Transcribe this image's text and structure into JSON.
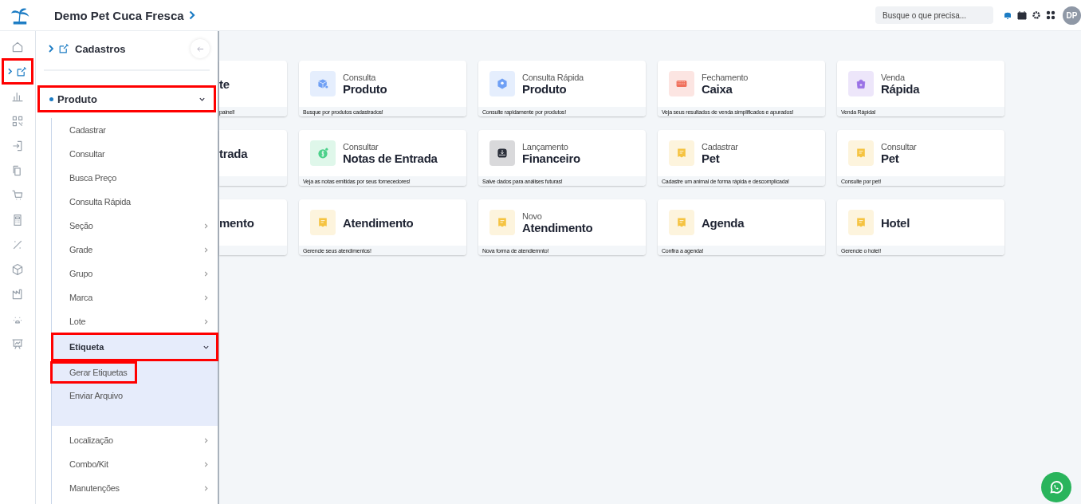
{
  "header": {
    "title": "Demo Pet Cuca Fresca",
    "search": {
      "placeholder": "Busque o que precisa..."
    },
    "avatar": "DP"
  },
  "rail": [
    {
      "selected": false,
      "annotated": false
    },
    {
      "selected": true,
      "annotated": true
    },
    {
      "selected": false,
      "annotated": false
    },
    {
      "selected": false,
      "annotated": false
    },
    {
      "selected": false,
      "annotated": false
    },
    {
      "selected": false,
      "annotated": false
    },
    {
      "selected": false,
      "annotated": false
    },
    {
      "selected": false,
      "annotated": false
    },
    {
      "selected": false,
      "annotated": false
    },
    {
      "selected": false,
      "annotated": false
    },
    {
      "selected": false,
      "annotated": false
    },
    {
      "selected": false,
      "annotated": false
    },
    {
      "selected": false,
      "annotated": false
    }
  ],
  "panel": {
    "title": "Cadastros",
    "section": {
      "label": "Produto",
      "expanded": true,
      "annotated": true,
      "items": [
        {
          "label": "Cadastrar",
          "expandable": false,
          "expanded": false,
          "annotated": false
        },
        {
          "label": "Consultar",
          "expandable": false,
          "expanded": false,
          "annotated": false
        },
        {
          "label": "Busca Preço",
          "expandable": false,
          "expanded": false,
          "annotated": false
        },
        {
          "label": "Consulta Rápida",
          "expandable": false,
          "expanded": false,
          "annotated": false
        },
        {
          "label": "Seção",
          "expandable": true,
          "expanded": false,
          "annotated": false
        },
        {
          "label": "Grade",
          "expandable": true,
          "expanded": false,
          "annotated": false
        },
        {
          "label": "Grupo",
          "expandable": true,
          "expanded": false,
          "annotated": false
        },
        {
          "label": "Marca",
          "expandable": true,
          "expanded": false,
          "annotated": false
        },
        {
          "label": "Lote",
          "expandable": true,
          "expanded": false,
          "annotated": false
        },
        {
          "label": "Etiqueta",
          "expandable": true,
          "expanded": true,
          "annotated": true,
          "children": [
            {
              "label": "Gerar Etiquetas",
              "annotated": true
            },
            {
              "label": "Enviar Arquivo",
              "annotated": false
            }
          ]
        },
        {
          "label": "Localização",
          "expandable": true,
          "expanded": false,
          "annotated": false
        },
        {
          "label": "Combo/Kit",
          "expandable": true,
          "expanded": false,
          "annotated": false
        },
        {
          "label": "Manutenções",
          "expandable": true,
          "expanded": false,
          "annotated": false
        }
      ]
    }
  },
  "cards": [
    {
      "kind": "covered",
      "title": "te",
      "desc": "painel!"
    },
    {
      "kind": "box",
      "subtitle": "Consulta",
      "title": "Produto",
      "desc": "Busque por produtos cadastrados!",
      "color": "#6fa0f5"
    },
    {
      "kind": "cube",
      "subtitle": "Consulta Rápida",
      "title": "Produto",
      "desc": "Consulte rapidamente por produtos!",
      "color": "#6fa0f5"
    },
    {
      "kind": "keyboard",
      "subtitle": "Fechamento",
      "title": "Caixa",
      "desc": "Veja seus resultados de venda simplificados e apurados!",
      "color": "#f0705c"
    },
    {
      "kind": "bag",
      "subtitle": "Venda",
      "title": "Rápida",
      "desc": "Venda Rápida!",
      "color": "#9a72e6"
    },
    {
      "kind": "covered",
      "title": "trada"
    },
    {
      "kind": "coin",
      "subtitle": "Consultar",
      "title": "Notas de Entrada",
      "desc": "Veja as notas emitidas por seus fornecedores!",
      "color": "#4bd18a"
    },
    {
      "kind": "download",
      "subtitle": "Lançamento",
      "title": "Financeiro",
      "desc": "Salve dados para análises futuras!",
      "color": "#2b2f3a"
    },
    {
      "kind": "note",
      "subtitle": "Cadastrar",
      "title": "Pet",
      "desc": "Cadastre um animal de forma rápida e descomplicada!",
      "color": "#f5c341"
    },
    {
      "kind": "note",
      "subtitle": "Consultar",
      "title": "Pet",
      "desc": "Consulte por pet!",
      "color": "#f5c341"
    },
    {
      "kind": "covered",
      "title": "mento"
    },
    {
      "kind": "note",
      "title": "Atendimento",
      "desc": "Gerencie seus atendimentos!",
      "color": "#f5c341"
    },
    {
      "kind": "note",
      "subtitle": "Novo",
      "title": "Atendimento",
      "desc": "Nova forma de atendiemnto!",
      "color": "#f5c341"
    },
    {
      "kind": "note",
      "title": "Agenda",
      "desc": "Confira a agenda!",
      "color": "#f5c341"
    },
    {
      "kind": "note",
      "title": "Hotel",
      "desc": "Gerencie o hotel!",
      "color": "#f5c341"
    }
  ]
}
